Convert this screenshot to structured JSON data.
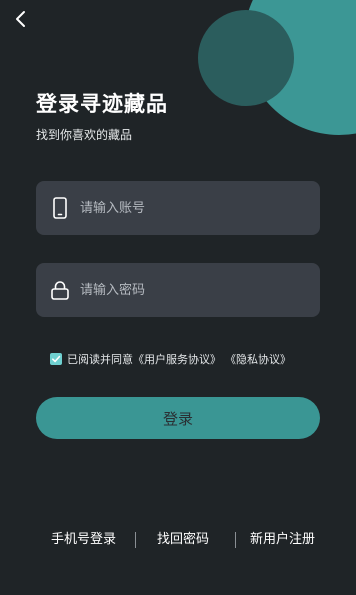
{
  "header": {
    "back_icon": "chevron-left-icon",
    "title": "登录寻迹藏品",
    "subtitle": "找到你喜欢的藏品"
  },
  "form": {
    "account": {
      "icon": "phone-icon",
      "placeholder": "请输入账号",
      "value": ""
    },
    "password": {
      "icon": "lock-icon",
      "placeholder": "请输入密码",
      "value": ""
    },
    "agreement": {
      "checked": true,
      "prefix": "已阅读并同意",
      "service_link": "《用户服务协议》",
      "privacy_link": "《隐私协议》"
    },
    "login_label": "登录"
  },
  "footer": {
    "phone_login": "手机号登录",
    "recover_password": "找回密码",
    "register": "新用户注册"
  },
  "colors": {
    "background": "#1f2427",
    "accent": "#3a9694",
    "field_bg": "#3a3f47",
    "checkbox": "#6fd0d0"
  }
}
